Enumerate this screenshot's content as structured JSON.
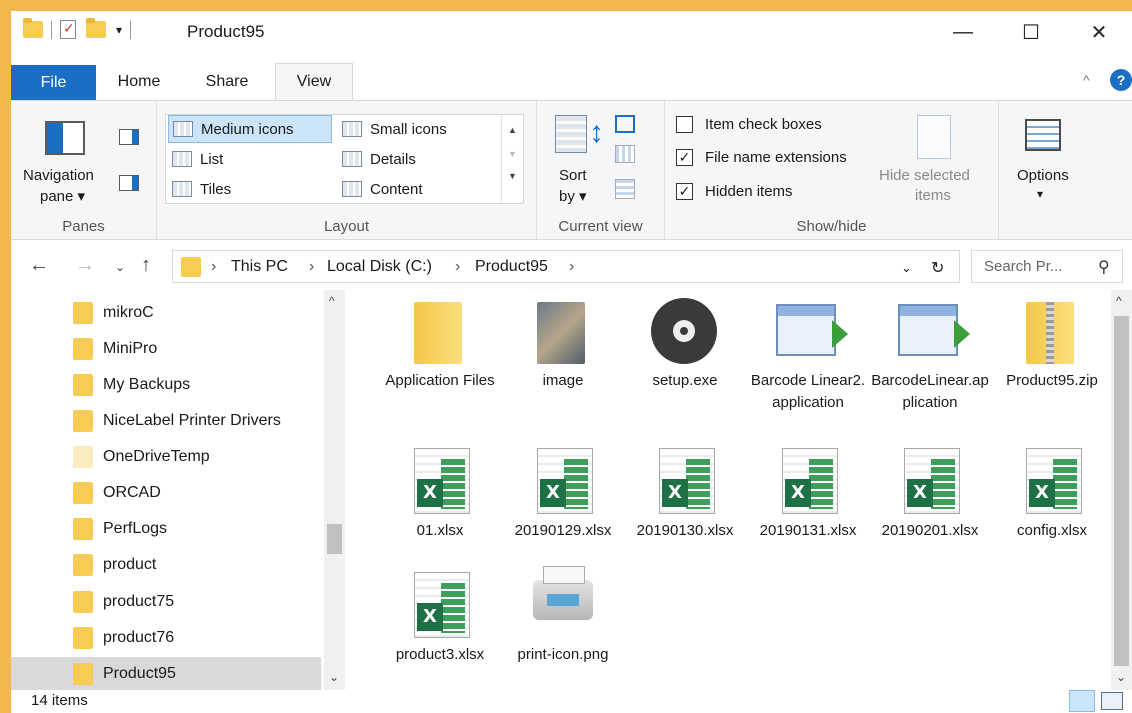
{
  "window": {
    "title": "Product95",
    "minimize": "—",
    "maximize": "☐",
    "close": "✕"
  },
  "tabs": {
    "file": "File",
    "home": "Home",
    "share": "Share",
    "view": "View"
  },
  "ribbon": {
    "panes": {
      "label": "Panes",
      "navigation_pane_line1": "Navigation",
      "navigation_pane_line2": "pane ▾"
    },
    "layout": {
      "label": "Layout",
      "options": [
        "Medium icons",
        "Small icons",
        "List",
        "Details",
        "Tiles",
        "Content"
      ],
      "selected": "Medium icons"
    },
    "current_view": {
      "label": "Current view",
      "sort_line1": "Sort",
      "sort_line2": "by ▾"
    },
    "show_hide": {
      "label": "Show/hide",
      "item_check_boxes": {
        "label": "Item check boxes",
        "checked": false
      },
      "file_name_extensions": {
        "label": "File name extensions",
        "checked": true
      },
      "hidden_items": {
        "label": "Hidden items",
        "checked": true
      },
      "hide_selected_line1": "Hide selected",
      "hide_selected_line2": "items"
    },
    "options": {
      "label": "Options",
      "arrow": "▾"
    }
  },
  "address": {
    "crumbs": [
      "This PC",
      "Local Disk (C:)",
      "Product95"
    ],
    "search_placeholder": "Search Pr..."
  },
  "sidebar": {
    "items": [
      "mikroC",
      "MiniPro",
      "My Backups",
      "NiceLabel Printer Drivers",
      "OneDriveTemp",
      "ORCAD",
      "PerfLogs",
      "product",
      "product75",
      "product76",
      "Product95"
    ],
    "selected": "Product95"
  },
  "files": [
    {
      "name": "Application Files",
      "icon": "folder-icon"
    },
    {
      "name": "image",
      "icon": "image-folder-icon"
    },
    {
      "name": "setup.exe",
      "icon": "disc-icon"
    },
    {
      "name": "Barcode Linear2.application",
      "icon": "application-icon"
    },
    {
      "name": "BarcodeLinear.application",
      "icon": "application-icon"
    },
    {
      "name": "Product95.zip",
      "icon": "zip-folder-icon"
    },
    {
      "name": "01.xlsx",
      "icon": "excel-icon"
    },
    {
      "name": "20190129.xlsx",
      "icon": "excel-icon"
    },
    {
      "name": "20190130.xlsx",
      "icon": "excel-icon"
    },
    {
      "name": "20190131.xlsx",
      "icon": "excel-icon"
    },
    {
      "name": "20190201.xlsx",
      "icon": "excel-icon"
    },
    {
      "name": "config.xlsx",
      "icon": "excel-icon"
    },
    {
      "name": "product3.xlsx",
      "icon": "excel-icon"
    },
    {
      "name": "print-icon.png",
      "icon": "printer-icon"
    }
  ],
  "status": {
    "count": "14 items"
  },
  "colors": {
    "accent": "#1a6fc4",
    "frame": "#f2b84b",
    "folder": "#f6cc55",
    "excel": "#1e7145"
  }
}
